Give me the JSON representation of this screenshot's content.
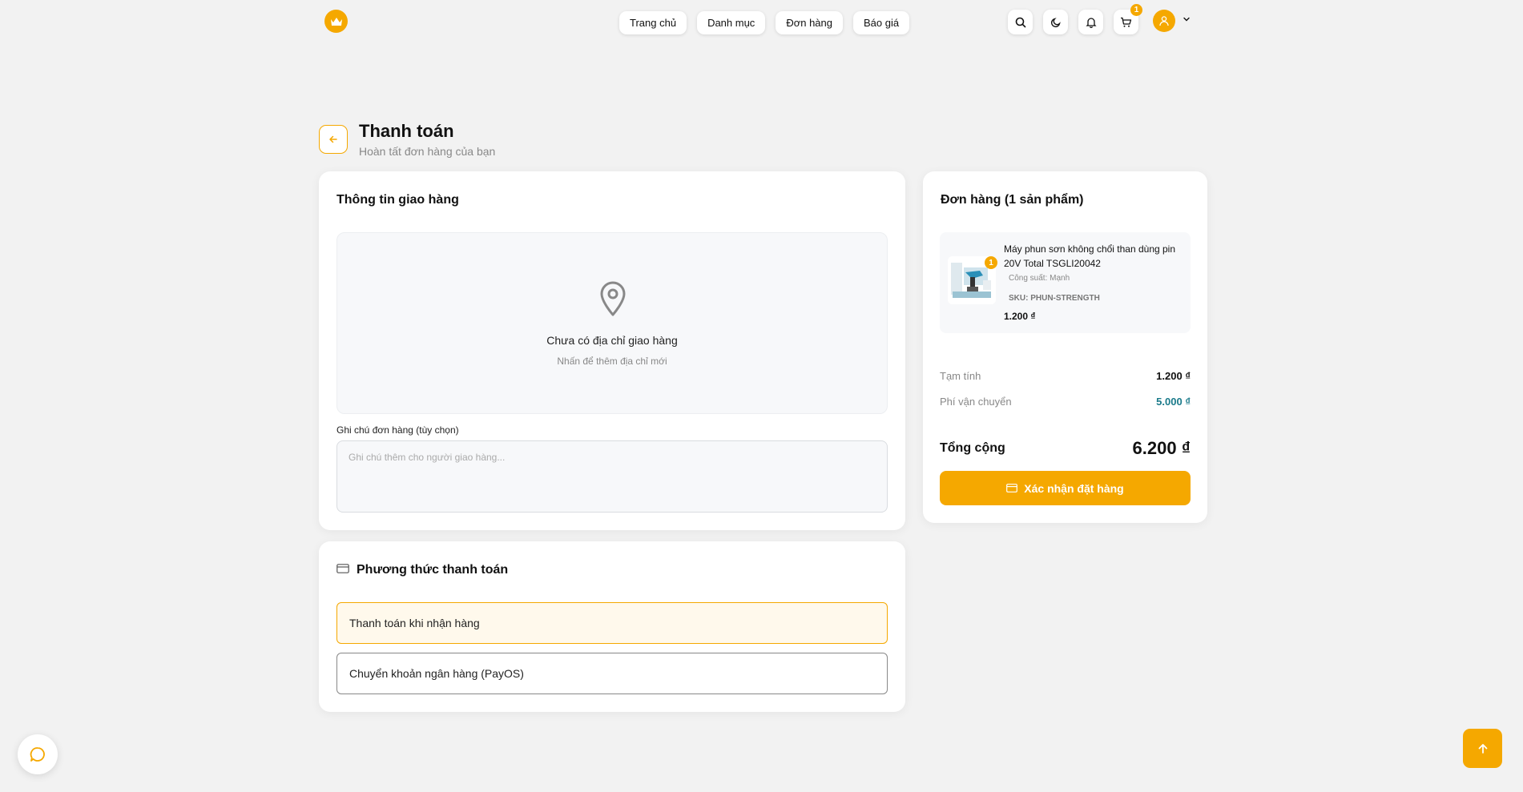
{
  "colors": {
    "accent": "#f5a800",
    "shipping_fee": "#1a7a8a",
    "background": "#f2f2f2"
  },
  "header": {
    "logo_icon": "crown-icon",
    "nav": [
      "Trang chủ",
      "Danh mục",
      "Đơn hàng",
      "Báo giá"
    ],
    "icons": [
      "search-icon",
      "moon-icon",
      "bell-icon",
      "cart-icon"
    ],
    "cart_count": "1",
    "avatar_icon": "user-icon"
  },
  "page": {
    "title": "Thanh toán",
    "subtitle": "Hoàn tất đơn hàng của bạn"
  },
  "shipping": {
    "title": "Thông tin giao hàng",
    "empty_title": "Chưa có địa chỉ giao hàng",
    "empty_sub": "Nhấn để thêm địa chỉ mới",
    "note_label": "Ghi chú đơn hàng (tùy chọn)",
    "note_value": "",
    "note_placeholder": "Ghi chú thêm cho người giao hàng..."
  },
  "payment": {
    "title": "Phương thức thanh toán",
    "options": [
      {
        "label": "Thanh toán khi nhận hàng",
        "selected": true
      },
      {
        "label": "Chuyển khoản ngân hàng (PayOS)",
        "selected": false
      }
    ]
  },
  "order": {
    "title": "Đơn hàng (1 sản phẩm)",
    "item": {
      "name": "Máy phun sơn không chổi than dùng pin 20V Total TSGLI20042",
      "variant": "Công suất: Mạnh",
      "sku": "SKU: PHUN-STRENGTH",
      "price": "1.200 ₫",
      "qty": "1"
    },
    "subtotal_label": "Tạm tính",
    "subtotal": "1.200 ₫",
    "shipping_label": "Phí vận chuyển",
    "shipping_fee": "5.000 ₫",
    "total_label": "Tổng cộng",
    "total": "6.200 ₫",
    "confirm_label": "Xác nhận đặt hàng"
  }
}
